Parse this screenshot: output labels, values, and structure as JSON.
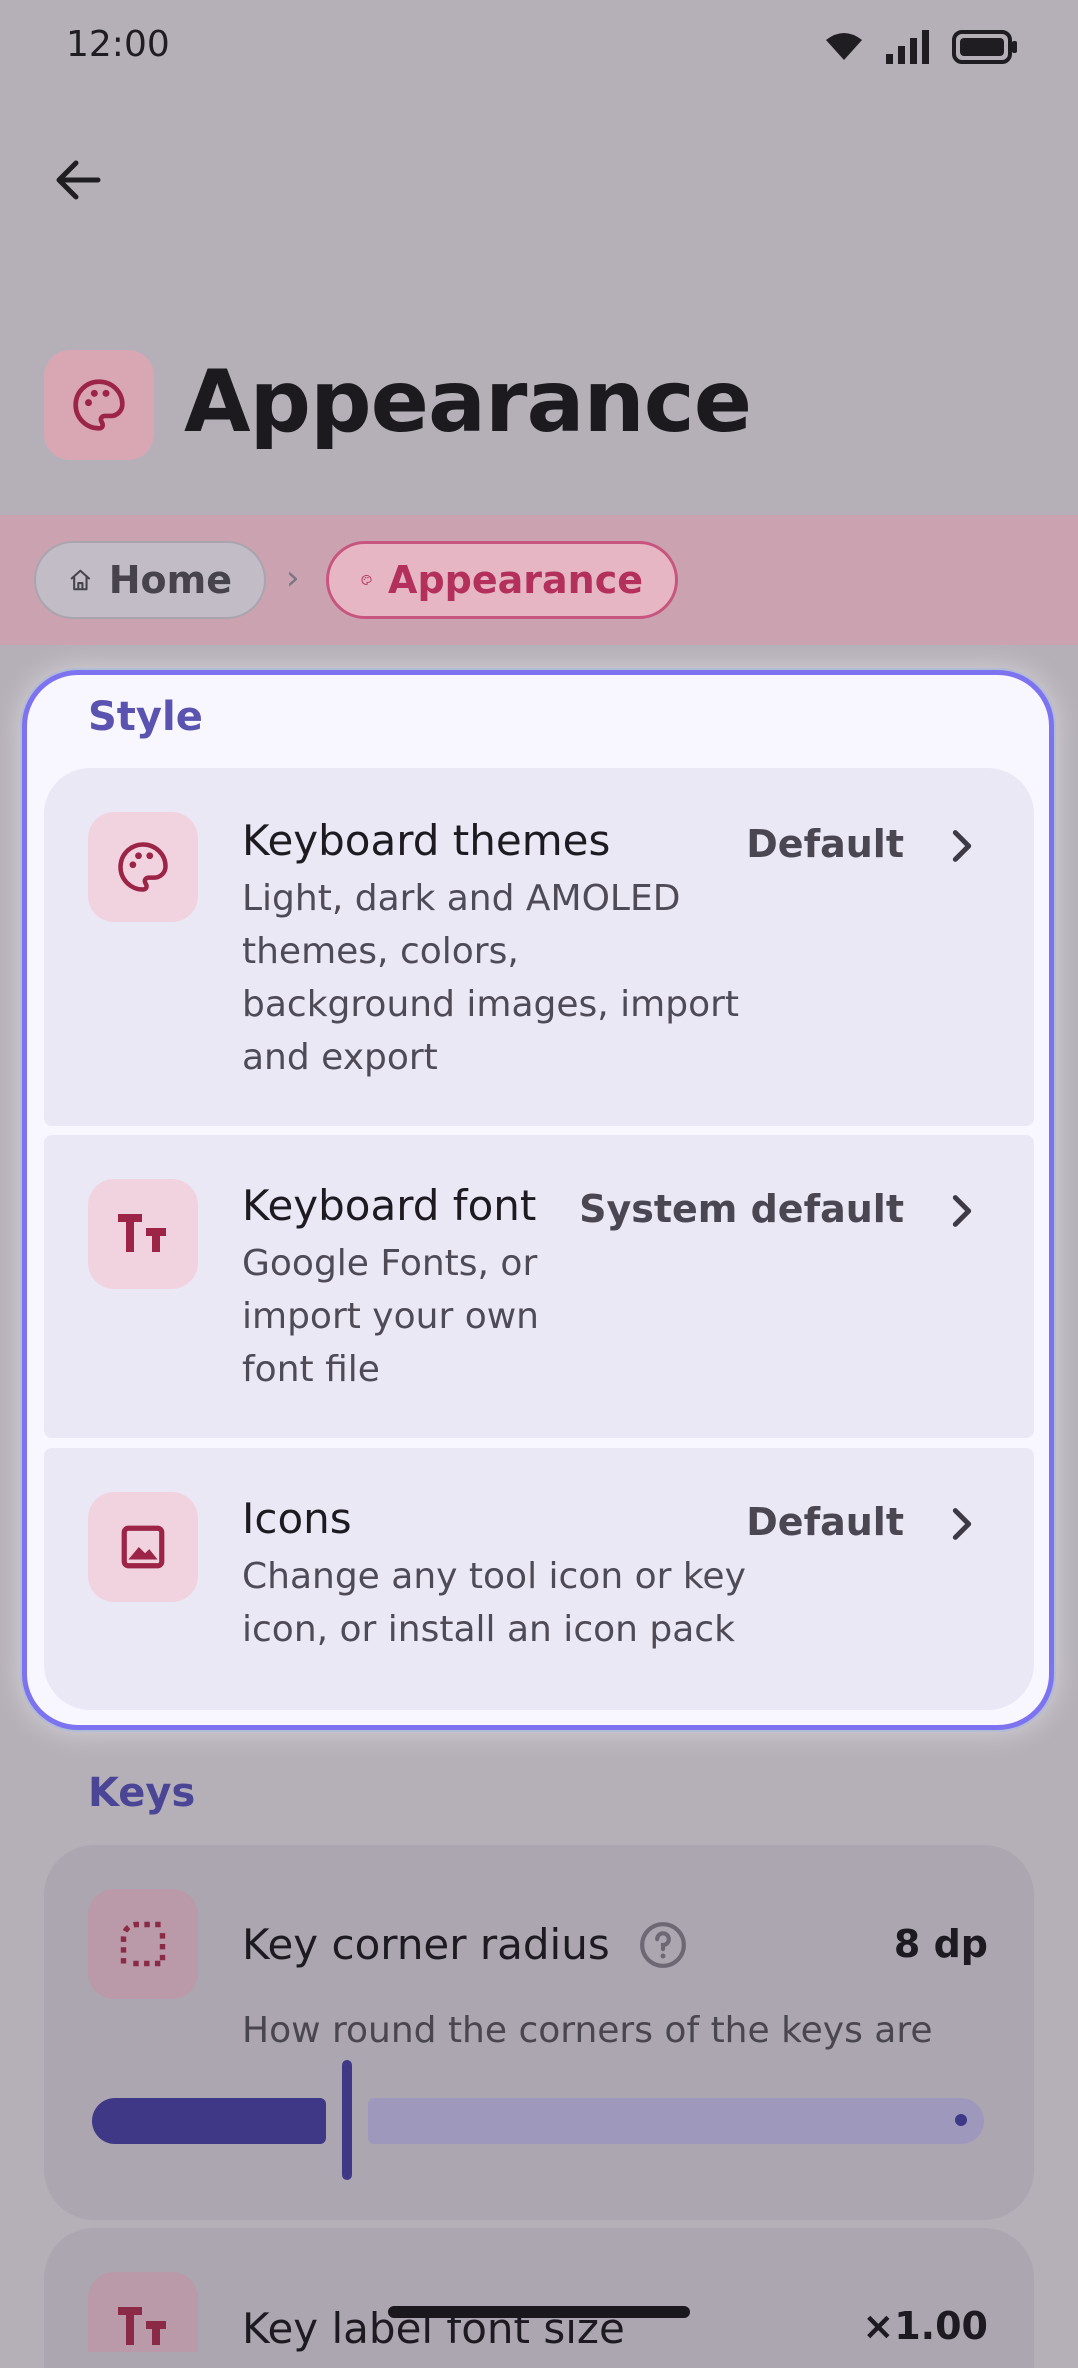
{
  "status_bar": {
    "time": "12:00"
  },
  "header": {
    "title": "Appearance"
  },
  "breadcrumb": {
    "home": "Home",
    "separator": "›",
    "current": "Appearance"
  },
  "style_section": {
    "label": "Style",
    "items": [
      {
        "title": "Keyboard themes",
        "subtitle_lines": [
          "Light, dark and AMOLED",
          "themes, colors,",
          "background images, import",
          "and export"
        ],
        "value": "Default",
        "icon": "palette-icon"
      },
      {
        "title": "Keyboard font",
        "subtitle_lines": [
          "Google Fonts, or",
          "import your own",
          "font file"
        ],
        "value": "System default",
        "icon": "text-size-icon"
      },
      {
        "title": "Icons",
        "subtitle_lines": [
          "Change any tool icon or key",
          "icon, or install an icon pack"
        ],
        "value": "Default",
        "icon": "image-icon"
      }
    ]
  },
  "keys_section": {
    "label": "Keys",
    "corner_radius": {
      "title": "Key corner radius",
      "value": "8 dp",
      "description": "How round the corners of the keys are",
      "slider_fraction": 0.27,
      "icon": "rounded-corner-icon"
    },
    "font_size": {
      "title": "Key label font size",
      "value": "×1.00",
      "icon": "text-size-icon"
    }
  },
  "colors": {
    "accent": "#7d73f0",
    "brand": "#b32f5c",
    "section_label": "#5b53b0",
    "slider": "#3e3886"
  }
}
